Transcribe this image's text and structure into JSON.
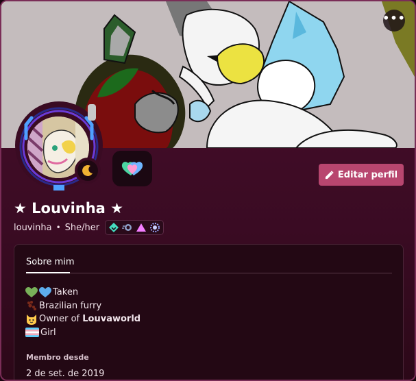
{
  "profile": {
    "display_name": "★ Louvinha ★",
    "username": "louvinha",
    "separator": "•",
    "pronouns": "She/her",
    "badges": [
      "hypesquad-balance-icon",
      "nitro-rocket-icon",
      "triangle-badge-icon",
      "quest-badge-icon"
    ]
  },
  "actions": {
    "edit_profile_label": "Editar perfil",
    "more_label": "•••"
  },
  "about": {
    "tab_label": "Sobre mim",
    "bio": [
      {
        "icons": [
          "green-heart-icon",
          "blue-heart-icon"
        ],
        "text": "Taken"
      },
      {
        "icons": [
          "paw-prints-icon"
        ],
        "text": "Brazilian furry"
      },
      {
        "icons": [
          "cat-face-icon"
        ],
        "text_prefix": "Owner of ",
        "text_bold": "Louvaworld"
      },
      {
        "icons": [
          "transgender-flag-icon"
        ],
        "text": "Girl"
      }
    ]
  },
  "member_since": {
    "label": "Membro desde",
    "date": "2 de set. de 2019"
  },
  "colors": {
    "accent": "#b8466f",
    "panel": "#230814",
    "background": "#3a0b23"
  }
}
